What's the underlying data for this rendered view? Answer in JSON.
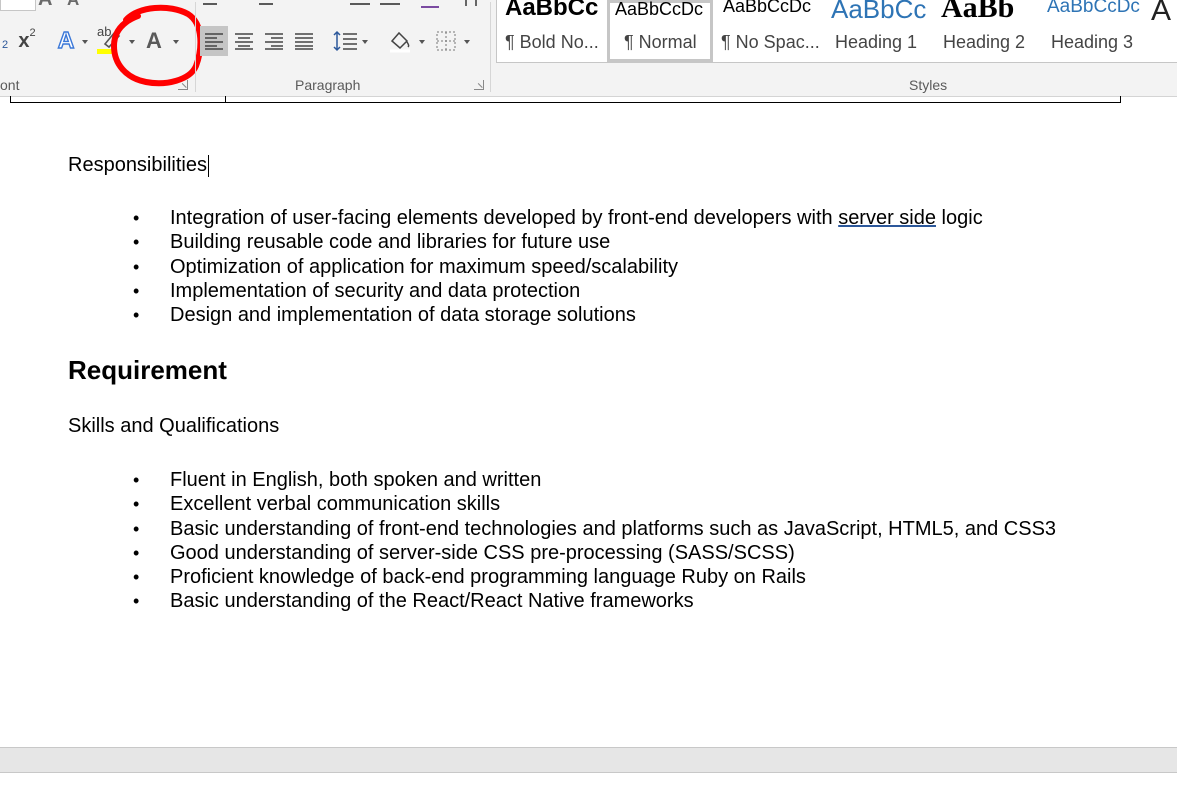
{
  "ribbon": {
    "groups": {
      "font_label": "ont",
      "paragraph_label": "Paragraph",
      "styles_label": "Styles"
    },
    "font": {
      "superscript_glyph": "x",
      "superscript_mark": "2",
      "subscript_mark": "2",
      "highlight_text": "ab",
      "font_color_glyph": "A",
      "text_effects_glyph": "A",
      "grow_font_glyph": "A",
      "shrink_font_glyph": "A",
      "highlight_color": "#ffff00",
      "font_color_accent": "#c00000"
    },
    "annotation": {
      "color": "#ff0000",
      "shape": "hand-drawn circle"
    },
    "styles": [
      {
        "sample": "AaBbCc",
        "name": "¶ Bold No...",
        "selected": false
      },
      {
        "sample": "AaBbCcDc",
        "name": "¶ Normal",
        "selected": true
      },
      {
        "sample": "AaBbCcDc",
        "name": "¶ No Spac...",
        "selected": false
      },
      {
        "sample": "AaBbCc",
        "name": "Heading 1",
        "selected": false
      },
      {
        "sample": "AaBb",
        "name": "Heading 2",
        "selected": false
      },
      {
        "sample": "AaBbCcDc",
        "name": "Heading 3",
        "selected": false
      }
    ]
  },
  "document": {
    "responsibilities_title": "Responsibilities",
    "responsibilities": [
      {
        "before": "Integration of user-facing elements developed by front-end developers with ",
        "flagged": "server side",
        "after": " logic"
      },
      {
        "before": "Building reusable code and libraries for future use",
        "flagged": "",
        "after": ""
      },
      {
        "before": "Optimization of application for maximum speed/scalability",
        "flagged": "",
        "after": ""
      },
      {
        "before": "Implementation of security and data protection",
        "flagged": "",
        "after": ""
      },
      {
        "before": "Design and implementation of data storage solutions",
        "flagged": "",
        "after": ""
      }
    ],
    "requirement_heading": "Requirement",
    "skills_title": "Skills and Qualifications",
    "skills": [
      "Fluent in English, both spoken and written",
      "Excellent verbal communication skills",
      "Basic understanding of front-end technologies and platforms such as JavaScript, HTML5, and CSS3",
      "Good understanding of server-side CSS pre-processing (SASS/SCSS)",
      "Proficient knowledge of back-end programming language Ruby on Rails",
      "Basic understanding of the React/React Native frameworks"
    ],
    "bullet_glyph": "•"
  }
}
